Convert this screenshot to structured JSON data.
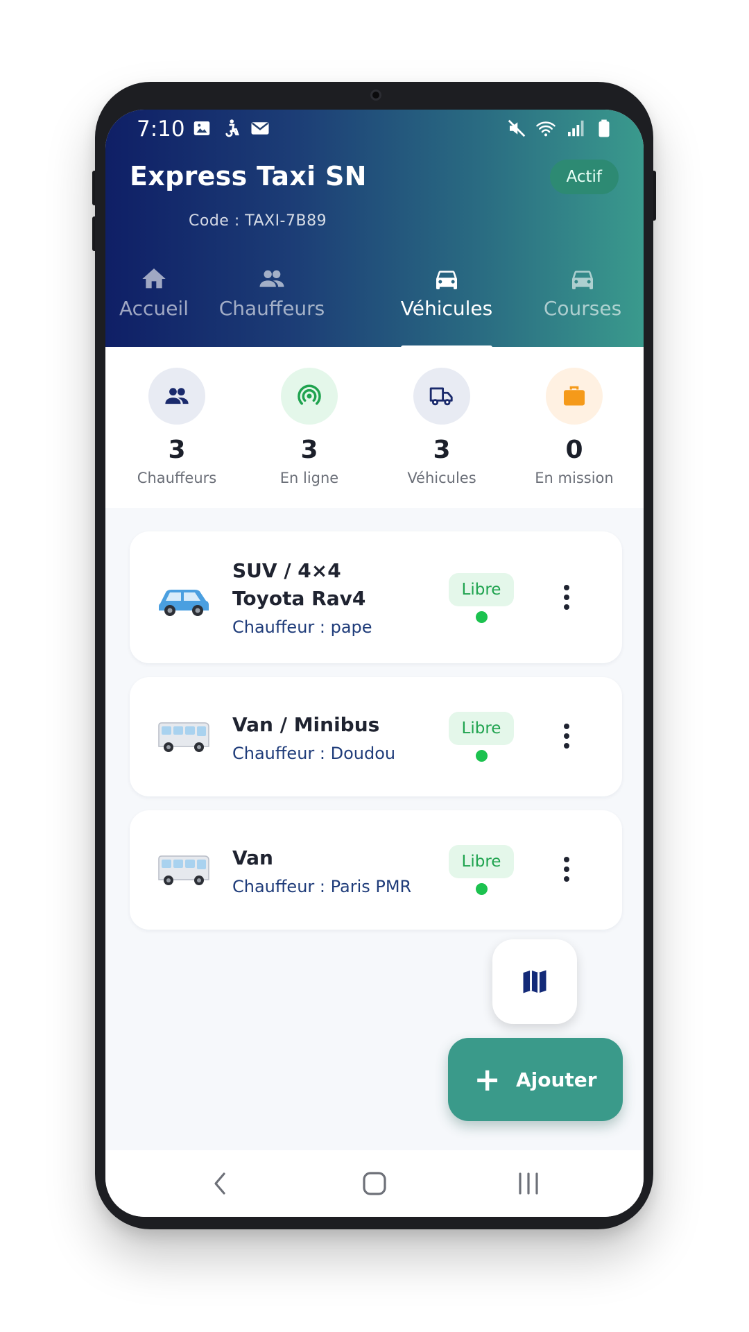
{
  "status_bar": {
    "time": "7:10",
    "left_icons": [
      "gallery-icon",
      "accessibility-icon",
      "mail-icon"
    ],
    "right_icons": [
      "mute-icon",
      "wifi-icon",
      "signal-icon",
      "battery-icon"
    ]
  },
  "header": {
    "company_name": "Express Taxi SN",
    "status_label": "Actif",
    "company_code": "Code : TAXI-7B89"
  },
  "tabs": [
    {
      "label": "Accueil",
      "icon": "home-icon",
      "active": false
    },
    {
      "label": "Chauffeurs",
      "icon": "people-icon",
      "active": false
    },
    {
      "label": "Véhicules",
      "icon": "car-icon",
      "active": true
    },
    {
      "label": "Courses",
      "icon": "car-icon",
      "active": false
    }
  ],
  "stats": [
    {
      "value": "3",
      "label": "Chauffeurs",
      "icon": "people-icon",
      "color": "#1a2a6c",
      "bg": "#e8ebf3"
    },
    {
      "value": "3",
      "label": "En ligne",
      "icon": "broadcast-icon",
      "color": "#1fa34f",
      "bg": "#e4f7ea"
    },
    {
      "value": "3",
      "label": "Véhicules",
      "icon": "truck-icon",
      "color": "#1a2a6c",
      "bg": "#e8ebf3"
    },
    {
      "value": "0",
      "label": "En mission",
      "icon": "briefcase-icon",
      "color": "#f59a1a",
      "bg": "#fff1e2"
    }
  ],
  "vehicles": [
    {
      "category": "SUV / 4×4",
      "model": "Toyota Rav4",
      "driver": "Chauffeur : pape",
      "status": "Libre",
      "icon": "suv-icon"
    },
    {
      "category": "Van / Minibus",
      "driver": "Chauffeur : Doudou",
      "status": "Libre",
      "icon": "minibus-icon"
    },
    {
      "category": "Van",
      "driver": "Chauffeur : Paris PMR",
      "status": "Libre",
      "icon": "minibus-icon"
    }
  ],
  "fab": {
    "add_label": "Ajouter",
    "map_icon": "map-icon"
  },
  "colors": {
    "header_start": "#0f1f66",
    "header_end": "#3a9a8d",
    "accent": "#3a9a8a",
    "status_free": "#1cc24f",
    "driver_text": "#1f3c7a"
  }
}
